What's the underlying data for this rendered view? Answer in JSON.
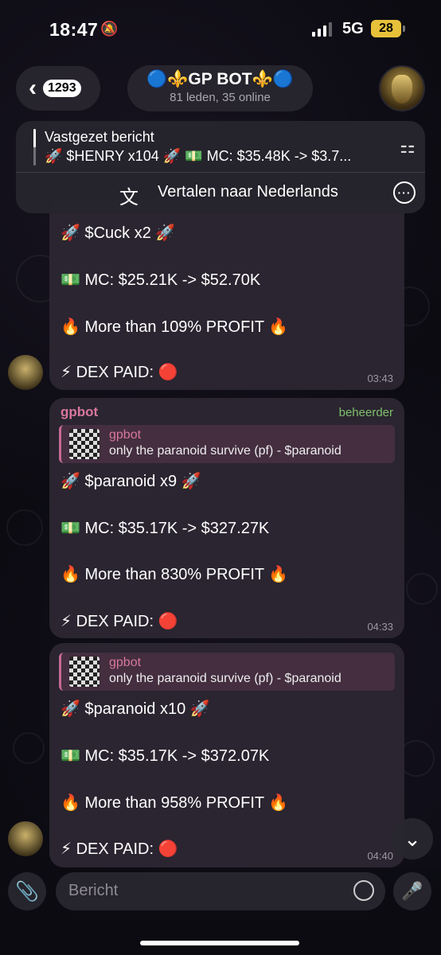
{
  "status": {
    "time": "18:47",
    "network": "5G",
    "battery": "28"
  },
  "header": {
    "back_count": "1293",
    "title": "🔵⚜️GP BOT⚜️🔵",
    "subtitle": "81 leden, 35 online"
  },
  "pinned": {
    "label": "Vastgezet bericht",
    "text": "🚀 $HENRY x104 🚀 💵 MC: $35.48K -> $3.7...",
    "translate": "Vertalen naar Nederlands"
  },
  "messages": [
    {
      "lines": [
        "🚀 $Cuck x2 🚀",
        "💵 MC: $25.21K -> $52.70K",
        "🔥 More than 109% PROFIT 🔥",
        "⚡ DEX PAID: 🔴"
      ],
      "time": "03:43"
    },
    {
      "sender": "gpbot",
      "badge": "beheerder",
      "reply_name": "gpbot",
      "reply_text": "only the paranoid survive (pf) - $paranoid",
      "lines": [
        "🚀 $paranoid x9 🚀",
        "💵 MC: $35.17K -> $327.27K",
        "🔥 More than 830% PROFIT 🔥",
        "⚡ DEX PAID: 🔴"
      ],
      "time": "04:33"
    },
    {
      "reply_name": "gpbot",
      "reply_text": "only the paranoid survive (pf) - $paranoid",
      "lines": [
        "🚀 $paranoid x10 🚀",
        "💵 MC: $35.17K -> $372.07K",
        "🔥 More than 958% PROFIT 🔥",
        "⚡ DEX PAID: 🔴"
      ],
      "time": "04:40"
    }
  ],
  "input": {
    "placeholder": "Bericht"
  },
  "icons": {
    "back": "chevron-left-icon",
    "pin": "pin-icon",
    "translate": "translate-icon",
    "more": "more-icon",
    "scroll": "chevron-down-icon",
    "attach": "paperclip-icon",
    "sticker": "sticker-icon",
    "mic": "microphone-icon"
  },
  "colors": {
    "sender": "#d9789c",
    "admin_badge": "#7fbf6b",
    "bubble": "#2a2530",
    "battery": "#e8c13a"
  }
}
